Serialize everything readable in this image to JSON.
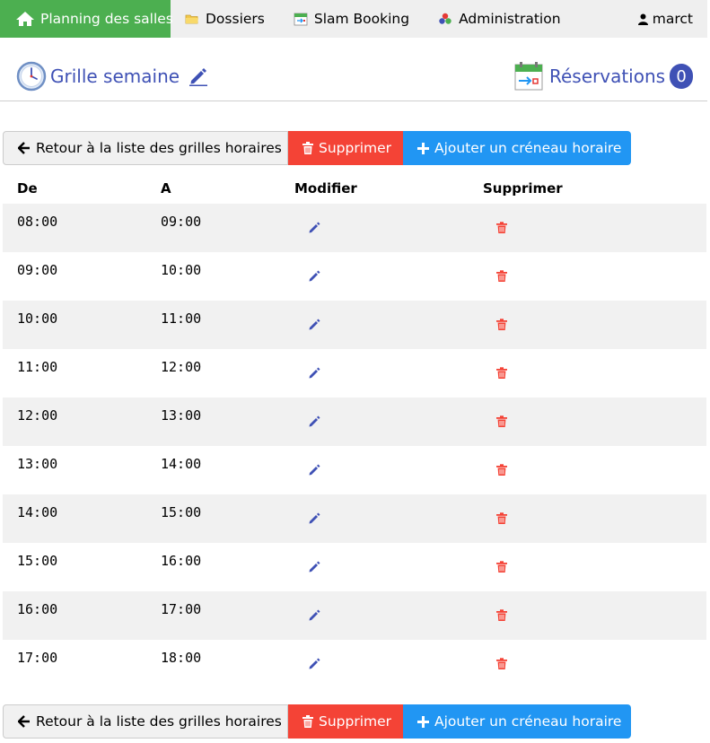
{
  "nav": {
    "home_label": "Planning des salles",
    "dossiers_label": "Dossiers",
    "slam_label": "Slam Booking",
    "admin_label": "Administration",
    "user_label": "marct",
    "home_color": "#4caf50"
  },
  "header": {
    "title": "Grille semaine",
    "reservations_label": "Réservations",
    "reservations_count": "0",
    "accent_color": "#3f51b5"
  },
  "actions": {
    "back_label": "Retour à la liste des grilles horaires",
    "delete_label": "Supprimer",
    "add_label": "Ajouter un créneau horaire",
    "delete_color": "#f44336",
    "add_color": "#2196f3"
  },
  "table": {
    "headers": {
      "from": "De",
      "to": "A",
      "edit": "Modifier",
      "delete": "Supprimer"
    },
    "rows": [
      {
        "from": "08:00",
        "to": "09:00"
      },
      {
        "from": "09:00",
        "to": "10:00"
      },
      {
        "from": "10:00",
        "to": "11:00"
      },
      {
        "from": "11:00",
        "to": "12:00"
      },
      {
        "from": "12:00",
        "to": "13:00"
      },
      {
        "from": "13:00",
        "to": "14:00"
      },
      {
        "from": "14:00",
        "to": "15:00"
      },
      {
        "from": "15:00",
        "to": "16:00"
      },
      {
        "from": "16:00",
        "to": "17:00"
      },
      {
        "from": "17:00",
        "to": "18:00"
      }
    ]
  },
  "icons": {
    "home": "home-icon",
    "folder": "folder-icon",
    "slam": "calendar-arrow-icon",
    "admin": "cubes-icon",
    "user": "user-icon",
    "clock": "clock-icon",
    "pencil": "pencil-icon",
    "calendar": "calendar-icon",
    "back": "arrow-left-icon",
    "trash": "trash-icon",
    "plus": "plus-icon"
  }
}
